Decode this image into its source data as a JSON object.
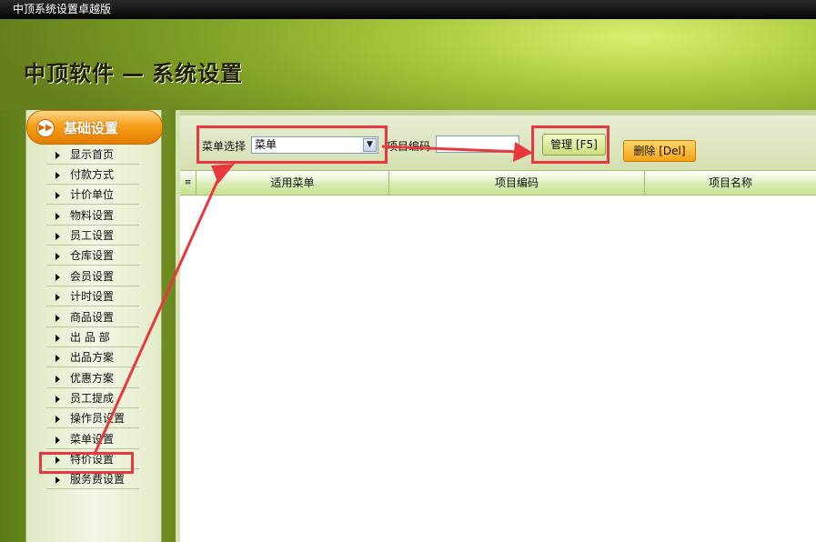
{
  "window": {
    "title": "中顶系统设置卓越版"
  },
  "header": {
    "brand": "中顶软件",
    "dash": "—",
    "section": "系统设置"
  },
  "sidebar": {
    "title": "基础设置",
    "title_icon": "double-right-arrow-icon",
    "items": [
      {
        "label": "显示首页"
      },
      {
        "label": "付款方式"
      },
      {
        "label": "计价单位"
      },
      {
        "label": "物料设置"
      },
      {
        "label": "员工设置"
      },
      {
        "label": "仓库设置"
      },
      {
        "label": "会员设置"
      },
      {
        "label": "计时设置"
      },
      {
        "label": "商品设置"
      },
      {
        "label": "出 品 部"
      },
      {
        "label": "出品方案"
      },
      {
        "label": "优惠方案"
      },
      {
        "label": "员工提成"
      },
      {
        "label": "操作员设置"
      },
      {
        "label": "菜单设置"
      },
      {
        "label": "特价设置"
      },
      {
        "label": "服务费设置"
      }
    ]
  },
  "toolbar": {
    "menu_select_label": "菜单选择",
    "menu_select_value": "菜单",
    "item_code_label": "项目编码",
    "item_code_value": "",
    "manage_button": "管理 [F5]",
    "delete_button": "删除 [Del]"
  },
  "grid": {
    "columns": [
      "适用菜单",
      "项目编码",
      "项目名称"
    ],
    "rows": []
  },
  "annotation_color": "#e8383d"
}
